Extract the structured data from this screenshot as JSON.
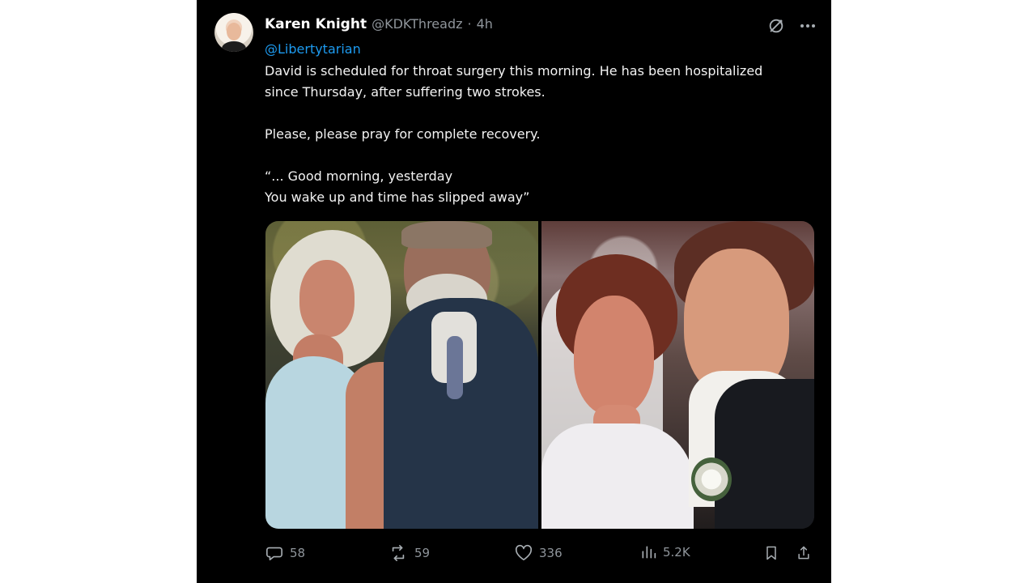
{
  "tweet": {
    "author_name": "Karen Knight",
    "handle": "@KDKThreadz",
    "separator": "·",
    "timestamp": "4h",
    "mention": "@Libertytarian",
    "lines": [
      "David is scheduled for throat surgery this morning.  He has been hospitalized",
      "since Thursday, after suffering two strokes.",
      "",
      "Please, please pray for complete recovery.",
      "",
      "“... Good morning, yesterday",
      "You wake up and time has slipped away”"
    ]
  },
  "actions": {
    "replies": "58",
    "reposts": "59",
    "likes": "336",
    "views": "5.2K"
  },
  "icons": {
    "grok": "grok-icon",
    "more": "more-icon",
    "reply": "reply-icon",
    "repost": "repost-icon",
    "like": "heart-icon",
    "views": "views-icon",
    "bookmark": "bookmark-icon",
    "share": "share-icon"
  },
  "colors": {
    "background": "#000000",
    "text": "#f3f3f3",
    "muted": "#8f959b",
    "link": "#1d9bf0"
  }
}
